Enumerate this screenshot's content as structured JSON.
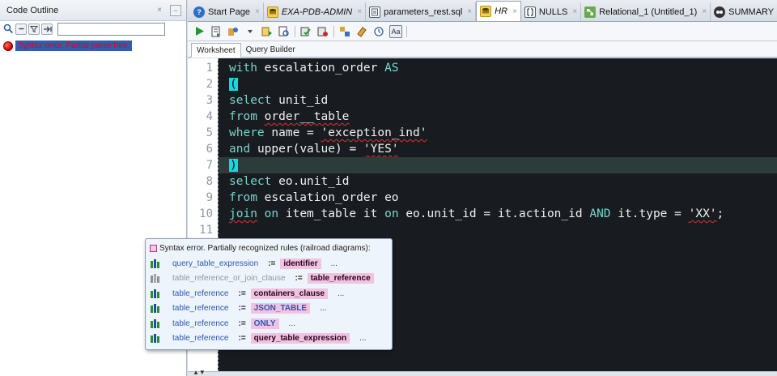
{
  "outline": {
    "title": "Code Outline",
    "close_glyph": "×",
    "minimize_glyph": "−",
    "search_value": "",
    "error_message": "Syntax error. Partial parse tree:"
  },
  "tabs": [
    {
      "label": "Start Page",
      "icon": "help-icon",
      "italic": false,
      "active": false
    },
    {
      "label": "EXA-PDB-ADMIN",
      "icon": "database-connection-icon",
      "italic": true,
      "active": false
    },
    {
      "label": "parameters_rest.sql",
      "icon": "sql-file-icon",
      "italic": false,
      "active": false
    },
    {
      "label": "HR",
      "icon": "database-connection-icon",
      "italic": true,
      "active": true
    },
    {
      "label": "NULLS",
      "icon": "nulls-icon",
      "italic": false,
      "active": false
    },
    {
      "label": "Relational_1 (Untitled_1)",
      "icon": "relational-model-icon",
      "italic": false,
      "active": false
    },
    {
      "label": "SUMMARY",
      "icon": "summary-icon",
      "italic": false,
      "active": false
    }
  ],
  "subtabs": {
    "worksheet": "Worksheet",
    "query_builder": "Query Builder"
  },
  "code": {
    "line_numbers": [
      "1",
      "2",
      "3",
      "4",
      "5",
      "6",
      "7",
      "8",
      "9",
      "10",
      "11"
    ],
    "lines": [
      "with escalation_order AS",
      "(",
      "select unit_id",
      "from order__table",
      "where name = 'exception_ind'",
      "and upper(value) = 'YES'",
      ")",
      "select eo.unit_id",
      "from escalation_order eo",
      "join on item_table it on eo.unit_id = it.action_id AND it.type = 'XX';",
      ""
    ]
  },
  "popup": {
    "title": "Syntax error. Partially recognized rules (railroad diagrams):",
    "rows": [
      {
        "name": "query_table_expression",
        "assign": ":=",
        "rhs": "identifier",
        "rest": "...",
        "icon": "green"
      },
      {
        "name": "table_reference_or_join_clause",
        "assign": ":=",
        "rhs": "table_reference",
        "rest": "",
        "icon": "gray"
      },
      {
        "name": "table_reference",
        "assign": ":=",
        "rhs": "containers_clause",
        "rest": "...",
        "icon": "green"
      },
      {
        "name": "table_reference",
        "assign": ":=",
        "rhs": "JSON_TABLE",
        "rest": "...",
        "icon": "green"
      },
      {
        "name": "table_reference",
        "assign": ":=",
        "rhs": "ONLY",
        "rest": "...",
        "icon": "green"
      },
      {
        "name": "table_reference",
        "assign": ":=",
        "rhs": "query_table_expression",
        "rest": "...",
        "icon": "green"
      }
    ]
  },
  "colors": {
    "editor_bg": "#181c20",
    "keyword": "#78d5ce",
    "error_red": "#e0002a",
    "selection_blue": "#2f5fa8",
    "popup_highlight": "#f0c3e0"
  }
}
